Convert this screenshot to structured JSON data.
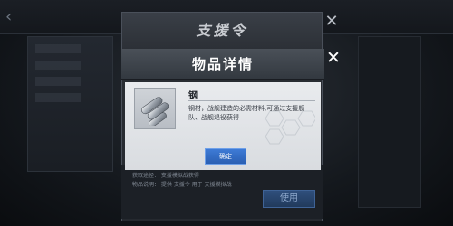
{
  "background": {
    "back_symbol": "‹",
    "support_dialog": {
      "title": "支援令",
      "close_symbol": "✕",
      "info_line_1": "获取途径：  支援模拟战获得",
      "info_line_2": "物品说明：  提供 支援令 用于 支援模拟战",
      "use_label": "使用"
    }
  },
  "modal": {
    "title": "物品详情",
    "close_symbol": "✕",
    "item": {
      "name": "钢",
      "icon": "steel-ingot-icon",
      "description": "钢材，战舰建造的必需材料,可通过支援舰队、战舰退役获得"
    },
    "confirm_label": "确定"
  },
  "colors": {
    "confirm_button": "#2a5fb3",
    "modal_header": "#3a4048",
    "modal_body": "#e3e6e9"
  }
}
